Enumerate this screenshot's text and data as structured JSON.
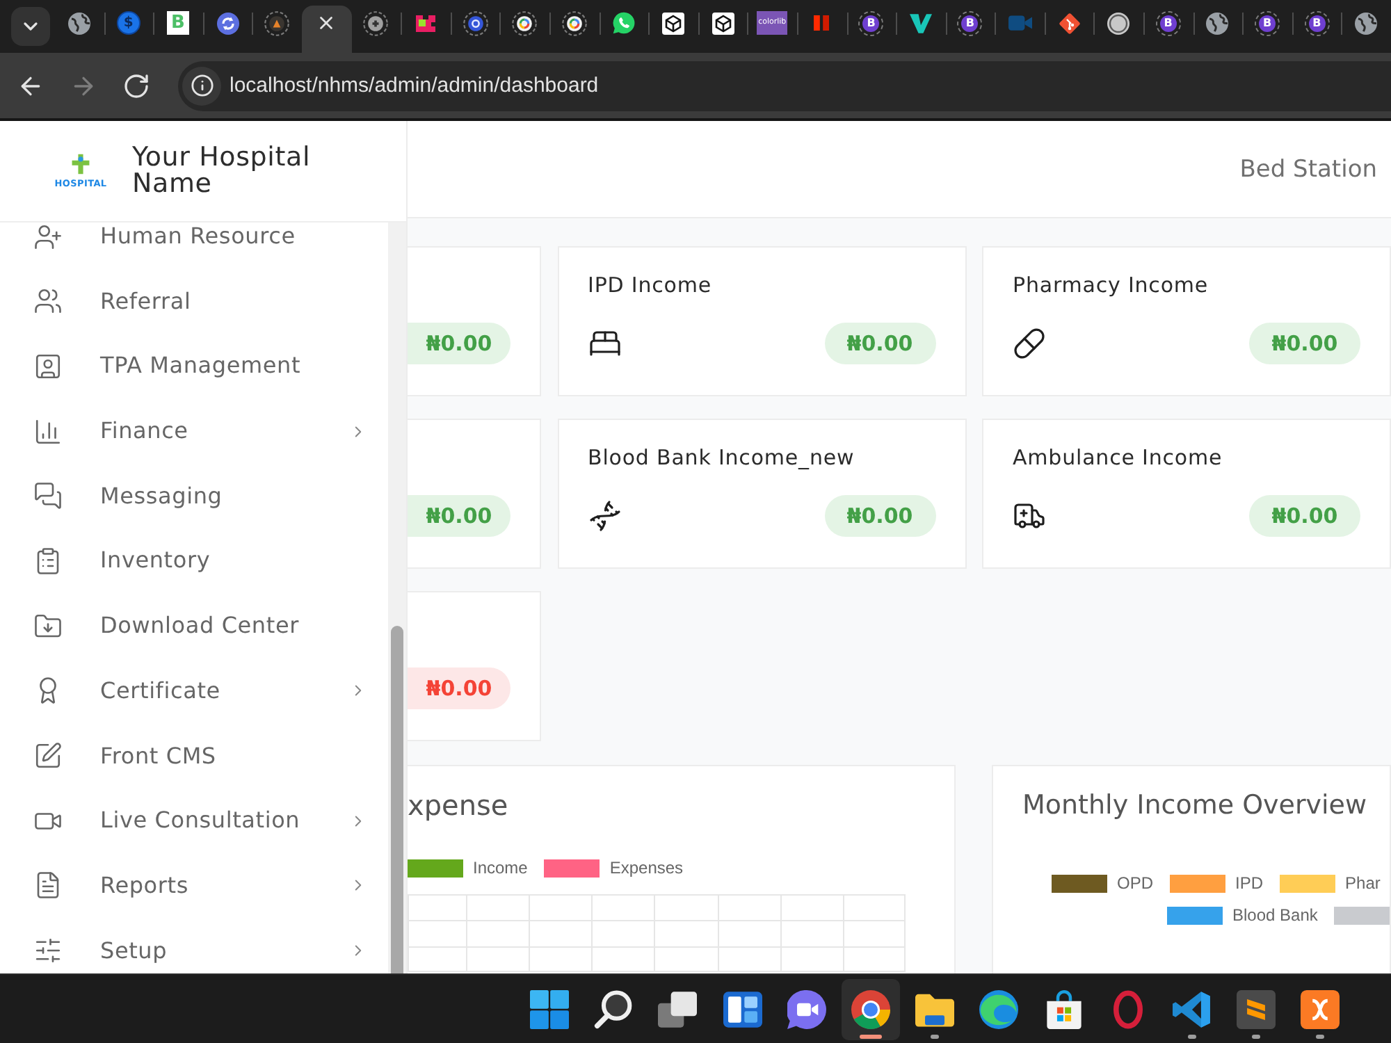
{
  "browser": {
    "tabs": [
      {
        "selected": false
      },
      {
        "glyph": "$",
        "selected": false
      },
      {
        "glyph": "B",
        "selected": false
      },
      {
        "selected": false
      },
      {
        "selected": false
      },
      {
        "selected": true
      },
      {
        "selected": false
      },
      {
        "selected": false
      },
      {
        "selected": false
      },
      {
        "selected": false
      },
      {
        "selected": false
      },
      {
        "selected": false
      },
      {
        "selected": false
      },
      {
        "selected": false
      },
      {
        "glyph": "colorlib",
        "selected": false
      },
      {
        "selected": false
      },
      {
        "glyph": "B",
        "selected": false
      },
      {
        "selected": false
      },
      {
        "glyph": "B",
        "selected": false
      },
      {
        "selected": false
      },
      {
        "selected": false
      },
      {
        "selected": false
      },
      {
        "glyph": "B",
        "selected": false
      },
      {
        "selected": false
      },
      {
        "glyph": "B",
        "selected": false
      },
      {
        "glyph": "B",
        "selected": false
      },
      {
        "selected": false
      }
    ],
    "nav_buttons": [
      {
        "disabled": false
      },
      {
        "disabled": true
      },
      {
        "disabled": false
      }
    ],
    "address": "localhost/nhms/admin/admin/dashboard"
  },
  "sidebar": {
    "logo_text": "HOSPITAL",
    "hospital_name": "Your Hospital Name",
    "items": [
      {
        "label": "Human Resource",
        "submenu": false
      },
      {
        "label": "Referral",
        "submenu": false
      },
      {
        "label": "TPA Management",
        "submenu": false
      },
      {
        "label": "Finance",
        "submenu": true
      },
      {
        "label": "Messaging",
        "submenu": false
      },
      {
        "label": "Inventory",
        "submenu": false
      },
      {
        "label": "Download Center",
        "submenu": false
      },
      {
        "label": "Certificate",
        "submenu": true
      },
      {
        "label": "Front CMS",
        "submenu": false
      },
      {
        "label": "Live Consultation",
        "submenu": true
      },
      {
        "label": "Reports",
        "submenu": true
      },
      {
        "label": "Setup",
        "submenu": true
      }
    ]
  },
  "header": {
    "bed_station": "Bed Station"
  },
  "income_cards": [
    {
      "amount": "₦0.00",
      "kind": "income"
    },
    {
      "title": "IPD Income",
      "amount": "₦0.00",
      "kind": "income"
    },
    {
      "title": "Pharmacy Income",
      "amount": "₦0.00",
      "kind": "income"
    },
    {
      "amount": "₦0.00",
      "kind": "income"
    },
    {
      "title": "Blood Bank Income_new",
      "amount": "₦0.00",
      "kind": "income"
    },
    {
      "title": "Ambulance Income",
      "amount": "₦0.00",
      "kind": "income"
    },
    {
      "amount": "₦0.00",
      "kind": "expense"
    }
  ],
  "charts": [
    {
      "title": "xpense",
      "legend_rows": [
        [
          {
            "label": "Income",
            "color": "#64a81c"
          },
          {
            "label": "Expenses",
            "color": "#ff6384"
          }
        ]
      ]
    },
    {
      "title": "Monthly Income Overview",
      "legend_rows": [
        [
          {
            "label": "OPD",
            "color": "#6e5a21"
          },
          {
            "label": "IPD",
            "color": "#ff9f40"
          },
          {
            "label": "Phar",
            "color": "#ffcd56"
          }
        ],
        [
          {
            "label": "Blood Bank",
            "color": "#36a2eb"
          },
          {
            "color": "#c9cbcf"
          }
        ]
      ]
    }
  ],
  "taskbar": [
    {
      "selected": false,
      "running": false
    },
    {
      "selected": false,
      "running": false
    },
    {
      "selected": false,
      "running": false
    },
    {
      "selected": false,
      "running": false
    },
    {
      "selected": false,
      "running": false
    },
    {
      "selected": true,
      "running": true
    },
    {
      "selected": false,
      "running": true
    },
    {
      "selected": false,
      "running": false
    },
    {
      "selected": false,
      "running": false
    },
    {
      "selected": false,
      "running": false
    },
    {
      "selected": false,
      "running": true
    },
    {
      "selected": false,
      "running": true
    },
    {
      "selected": false,
      "running": true
    }
  ]
}
